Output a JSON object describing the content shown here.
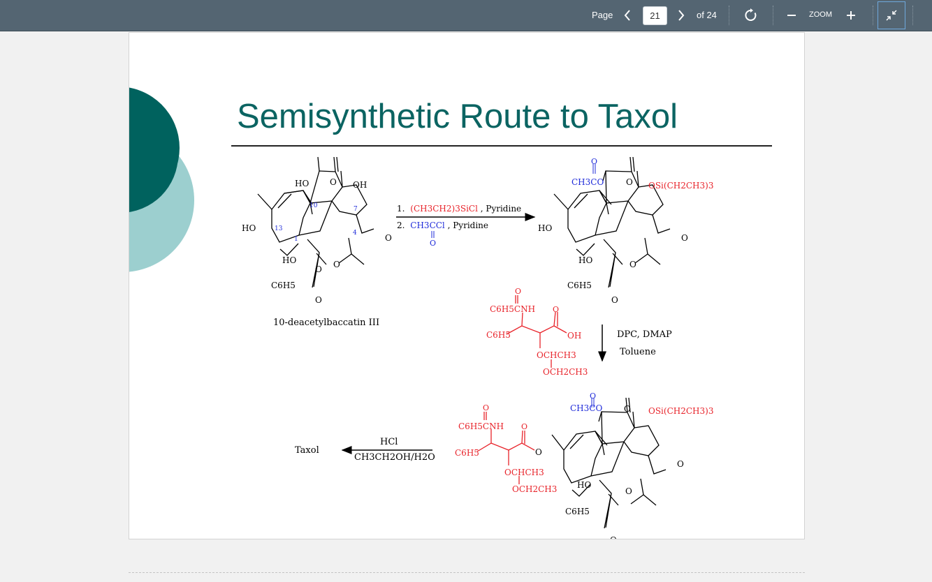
{
  "toolbar": {
    "page_label": "Page",
    "current_page": "21",
    "total_label": "of 24",
    "zoom_label": "ZOOM",
    "icons": [
      "chevron-left-icon",
      "chevron-right-icon",
      "rotate-icon",
      "zoom-out-icon",
      "zoom-in-icon",
      "exit-fullscreen-icon"
    ]
  },
  "slide": {
    "title": "Semisynthetic Route to Taxol",
    "colors": {
      "title": "#0b6462",
      "dark_teal": "#00625e",
      "light_teal": "#9ccfcf",
      "red": "#e8232a",
      "blue": "#1f2bd9"
    },
    "starting_material": {
      "name": "10-deacetylbaccatin III",
      "labels": [
        "HO",
        "OH",
        "HO",
        "HO",
        "O",
        "O",
        "O",
        "O",
        "O",
        "C6H5"
      ],
      "ring_numbers": [
        "10",
        "7",
        "13",
        "1",
        "4"
      ]
    },
    "step1": {
      "line1_prefix": "1.",
      "line1_reagent": "(CH3CH2)3SiCl",
      "line1_suffix": ", Pyridine",
      "line2_prefix": "2.",
      "line2_reagent": "CH3CCl",
      "line2_suffix": ", Pyridine",
      "line2_oxygen": "O"
    },
    "protected_intermediate": {
      "acetyl_label": "CH3CO",
      "acetyl_oxygen": "O",
      "silyl_label": "OSi(CH2CH3)3",
      "labels": [
        "HO",
        "HO",
        "O",
        "O",
        "O",
        "O",
        "C6H5"
      ]
    },
    "side_chain": {
      "amide_label": "C6H5CNH",
      "phenyl_label": "C6H5",
      "acid_label": "OH",
      "ether_label": "OCHCH3",
      "ethoxy_label": "OCH2CH3",
      "oxygens": [
        "O",
        "O"
      ]
    },
    "step2": {
      "reagent_line1": "DPC, DMAP",
      "reagent_line2": "Toluene"
    },
    "coupled_product": {
      "acetyl_label": "CH3CO",
      "silyl_label": "OSi(CH2CH3)3",
      "amide_label": "C6H5CNH",
      "phenyl_label": "C6H5",
      "ester_oxygen": "O",
      "ether_label": "OCHCH3",
      "ethoxy_label": "OCH2CH3",
      "labels": [
        "HO",
        "O",
        "O",
        "O",
        "O",
        "O",
        "O",
        "C6H5"
      ]
    },
    "step3": {
      "reagent_line1": "HCl",
      "reagent_line2": "CH3CH2OH/H2O",
      "product": "Taxol"
    }
  }
}
